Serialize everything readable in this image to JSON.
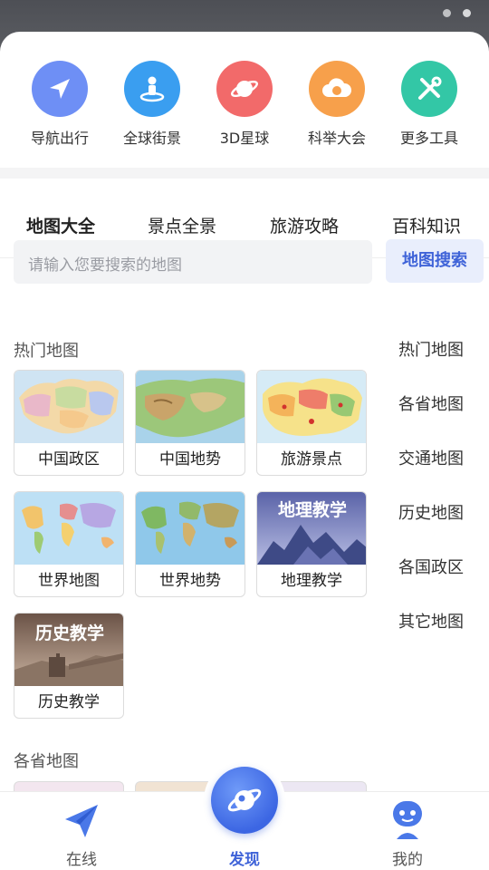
{
  "quick_actions": [
    {
      "label": "导航出行",
      "icon": "navigation-arrow-icon",
      "color": "#6e8ff5"
    },
    {
      "label": "全球街景",
      "icon": "street-view-icon",
      "color": "#3a9ef0"
    },
    {
      "label": "3D星球",
      "icon": "planet-icon",
      "color": "#f26a6a"
    },
    {
      "label": "科举大会",
      "icon": "cloud-exam-icon",
      "color": "#f7a04b"
    },
    {
      "label": "更多工具",
      "icon": "tools-icon",
      "color": "#33c7a6"
    }
  ],
  "tabs": [
    "地图大全",
    "景点全景",
    "旅游攻略",
    "百科知识"
  ],
  "active_tab": "地图大全",
  "search": {
    "placeholder": "请输入您要搜索的地图",
    "button": "地图搜索"
  },
  "sections": {
    "hot": "热门地图",
    "province": "各省地图"
  },
  "map_cards": [
    {
      "label": "中国政区"
    },
    {
      "label": "中国地势"
    },
    {
      "label": "旅游景点"
    },
    {
      "label": "世界地图"
    },
    {
      "label": "世界地势"
    },
    {
      "label": "地理教学",
      "overlay": "地理教学"
    },
    {
      "label": "历史教学",
      "overlay": "历史教学"
    }
  ],
  "side_menu": [
    "热门地图",
    "各省地图",
    "交通地图",
    "历史地图",
    "各国政区",
    "其它地图"
  ],
  "bottom_nav": [
    {
      "label": "在线",
      "icon": "paper-plane-icon"
    },
    {
      "label": "发现",
      "icon": "discover-planet-icon",
      "active": true
    },
    {
      "label": "我的",
      "icon": "profile-robot-icon"
    }
  ],
  "accent_color": "#3f63d8"
}
